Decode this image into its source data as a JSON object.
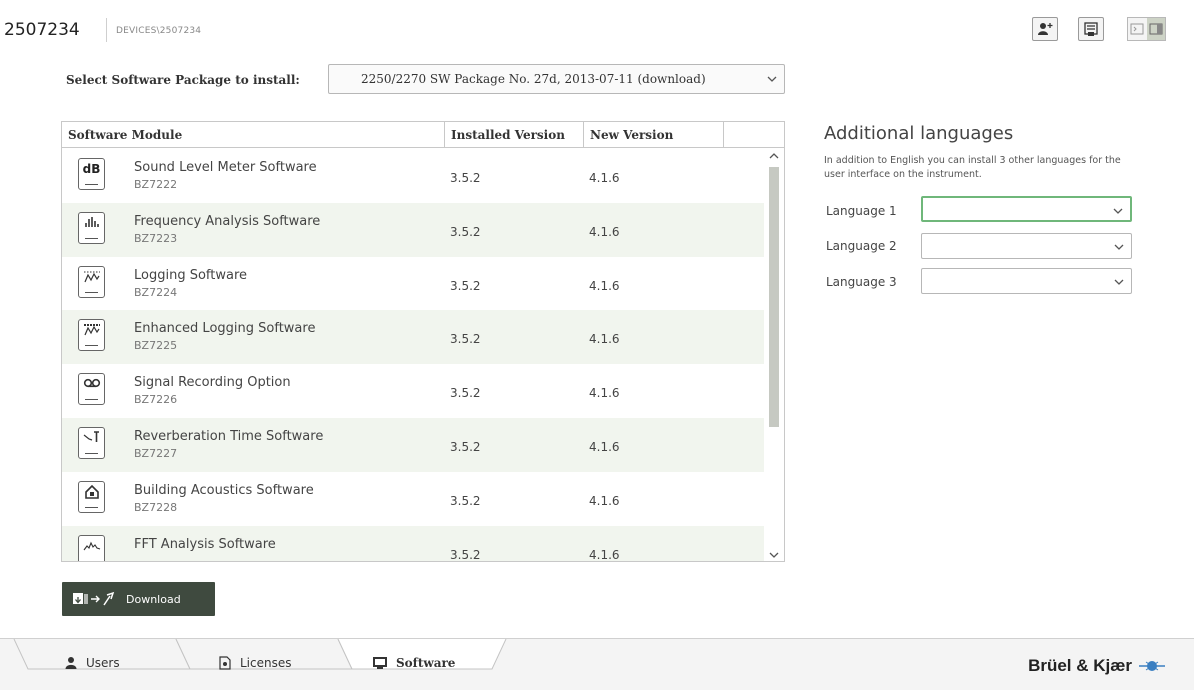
{
  "header": {
    "device_id": "2507234",
    "path": "DEVICES\\2507234",
    "icons": [
      "add-user-icon",
      "print-icon",
      "compact-view-icon",
      "panel-view-icon"
    ]
  },
  "package": {
    "label": "Select Software Package to install:",
    "selected": "2250/2270 SW Package No. 27d, 2013-07-11  (download)"
  },
  "table": {
    "headers": [
      "Software Module",
      "Installed Version",
      "New Version",
      ""
    ],
    "rows": [
      {
        "icon": "db-icon",
        "name": "Sound Level Meter Software",
        "code": "BZ7222",
        "installed": "3.5.2",
        "new": "4.1.6"
      },
      {
        "icon": "frequency-analysis-icon",
        "name": "Frequency Analysis Software",
        "code": "BZ7223",
        "installed": "3.5.2",
        "new": "4.1.6"
      },
      {
        "icon": "logging-icon",
        "name": "Logging Software",
        "code": "BZ7224",
        "installed": "3.5.2",
        "new": "4.1.6"
      },
      {
        "icon": "enhanced-logging-icon",
        "name": "Enhanced Logging Software",
        "code": "BZ7225",
        "installed": "3.5.2",
        "new": "4.1.6"
      },
      {
        "icon": "signal-recording-icon",
        "name": "Signal Recording Option",
        "code": "BZ7226",
        "installed": "3.5.2",
        "new": "4.1.6"
      },
      {
        "icon": "reverberation-time-icon",
        "name": "Reverberation Time Software",
        "code": "BZ7227",
        "installed": "3.5.2",
        "new": "4.1.6"
      },
      {
        "icon": "building-acoustics-icon",
        "name": "Building Acoustics Software",
        "code": "BZ7228",
        "installed": "3.5.2",
        "new": "4.1.6"
      },
      {
        "icon": "fft-analysis-icon",
        "name": "FFT Analysis Software",
        "code": "",
        "installed": "3.5.2",
        "new": "4.1.6"
      }
    ]
  },
  "download": {
    "label": "Download"
  },
  "languages": {
    "title": "Additional languages",
    "description": "In addition to English you can install 3 other languages for the user interface on the instrument.",
    "fields": [
      {
        "label": "Language 1",
        "value": ""
      },
      {
        "label": "Language 2",
        "value": ""
      },
      {
        "label": "Language 3",
        "value": ""
      }
    ]
  },
  "tabs": [
    {
      "label": "Users",
      "icon": "user-icon",
      "active": false
    },
    {
      "label": "Licenses",
      "icon": "license-icon",
      "active": false
    },
    {
      "label": "Software",
      "icon": "software-icon",
      "active": true
    }
  ],
  "brand": {
    "name": "Brüel & Kjær"
  },
  "colors": {
    "accent_green": "#6fb77a",
    "row_alt": "#f1f5ee",
    "download_bg": "#3f4a3f"
  }
}
